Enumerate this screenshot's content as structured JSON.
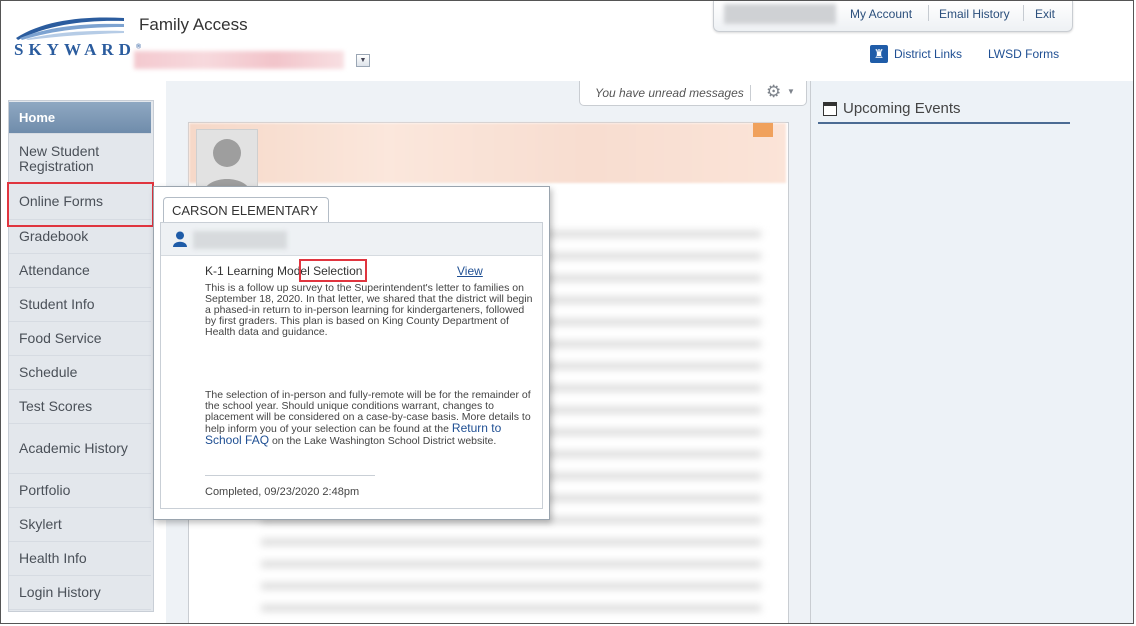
{
  "app": {
    "logo_text": "SKYWARD",
    "title": "Family Access"
  },
  "top_links": {
    "my_account": "My Account",
    "email_history": "Email History",
    "exit": "Exit"
  },
  "header_links": {
    "district_links": "District Links",
    "lwsd_forms": "LWSD Forms"
  },
  "sidebar": {
    "items": [
      {
        "label": "Home"
      },
      {
        "label": "New Student Registration"
      },
      {
        "label": "Online Forms"
      },
      {
        "label": "Gradebook"
      },
      {
        "label": "Attendance"
      },
      {
        "label": "Student Info"
      },
      {
        "label": "Food Service"
      },
      {
        "label": "Schedule"
      },
      {
        "label": "Test Scores"
      },
      {
        "label": "Academic History"
      },
      {
        "label": "Portfolio"
      },
      {
        "label": "Skylert"
      },
      {
        "label": "Health Info"
      },
      {
        "label": "Login History"
      }
    ]
  },
  "messages": {
    "unread": "You have unread messages"
  },
  "right_pane": {
    "title": "Upcoming Events"
  },
  "popup": {
    "tab": "CARSON ELEMENTARY",
    "form_title": "K-1 Learning Model Selection",
    "view_label": "View",
    "description_1": "This is a follow up survey to the Superintendent's letter to families on September 18, 2020. In that letter, we shared that the district will begin a phased-in return to in-person learning for kindergarteners, followed by first graders. This plan is based on King County Department of Health data and guidance.",
    "description_2_pre": "The selection of in-person and fully-remote will be for the remainder of the school year. Should unique conditions warrant, changes to placement will be considered on a case-by-case basis. More details to help inform you of your selection can be found at the ",
    "faq_link": "Return to School FAQ",
    "description_2_post": " on the Lake Washington School District website.",
    "completed": "Completed, 09/23/2020 2:48pm"
  },
  "colors": {
    "brand": "#2b5c9e",
    "link": "#1f4f93",
    "highlight": "#e0353f",
    "home_nav": "#7d97b5"
  }
}
